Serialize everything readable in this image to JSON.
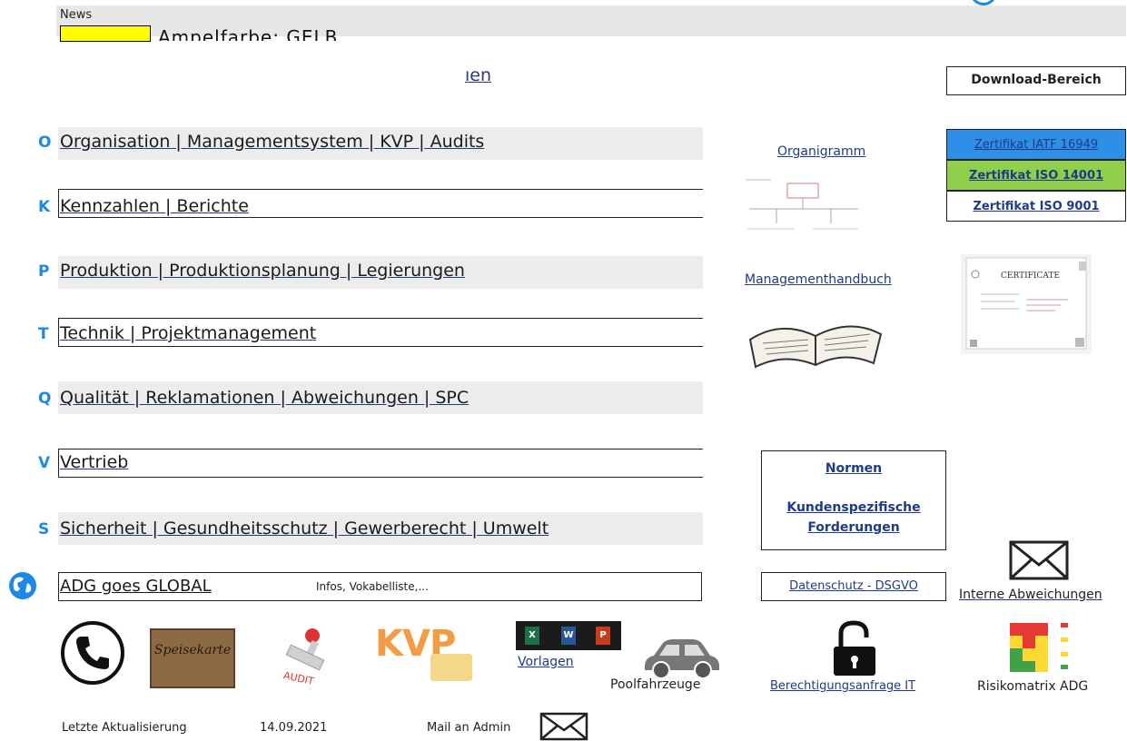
{
  "news": {
    "label": "News",
    "text": "Ampelfarbe: GELB",
    "swatch_color": "#ffff00"
  },
  "tab_tail": "ıen",
  "categories": [
    {
      "letter": "O",
      "label": "Organisation | Managementsystem | KVP | Audits"
    },
    {
      "letter": "K",
      "label": "Kennzahlen | Berichte"
    },
    {
      "letter": "P",
      "label": "Produktion | Produktionsplanung | Legierungen"
    },
    {
      "letter": "T",
      "label": "Technik | Projektmanagement"
    },
    {
      "letter": "Q",
      "label": "Qualität | Reklamationen | Abweichungen | SPC"
    },
    {
      "letter": "V",
      "label": "Vertrieb"
    },
    {
      "letter": "S",
      "label": "Sicherheit | Gesundheitsschutz | Gewerberecht | Umwelt"
    }
  ],
  "global": {
    "label": "ADG goes GLOBAL",
    "sub": "Infos, Vokabelliste,..."
  },
  "middle": {
    "organigramm": "Organigramm",
    "handbuch": "Managementhandbuch",
    "normen": "Normen",
    "kunden_line1": "Kundenspezifische",
    "kunden_line2": "Forderungen",
    "datenschutz": "Datenschutz - DSGVO"
  },
  "right": {
    "download": "Download-Bereich",
    "certs": [
      "Zertifikat IATF 16949",
      "Zertifikat ISO 14001",
      "Zertifikat ISO 9001"
    ],
    "cert_thumb_title": "CERTIFICATE",
    "abweichungen": "Interne Abweichungen"
  },
  "bottom": {
    "menu_card": "Speisekarte",
    "stamp": "AUDIT",
    "kvp": "KVP",
    "office_excel": "X",
    "office_word": "W",
    "office_ppt": "P",
    "vorlagen": "Vorlagen",
    "pool": "Poolfahrzeuge",
    "berechtigung": "Berechtigungsanfrage IT",
    "risiko": "Risikomatrix ADG"
  },
  "footer": {
    "updated_label": "Letzte Aktualisierung",
    "updated_date": "14.09.2021",
    "mail_admin": "Mail an Admin"
  },
  "colors": {
    "accent_blue": "#1e88e5",
    "link_blue": "#1f3a8a",
    "cert_iatf": "#2f8ee5",
    "cert_iso14001": "#8fcf4c",
    "kvp_orange": "#f39c45"
  }
}
